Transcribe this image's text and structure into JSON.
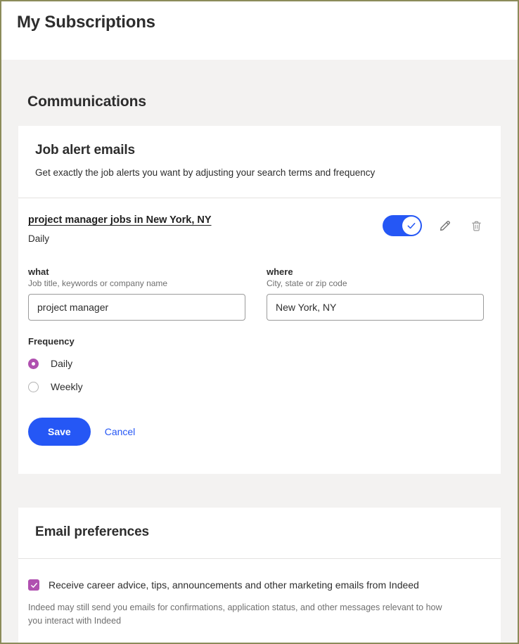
{
  "header": {
    "title": "My Subscriptions"
  },
  "section": {
    "heading": "Communications"
  },
  "job_alerts": {
    "card_title": "Job alert emails",
    "card_subtitle": "Get exactly the job alerts you want by adjusting your search terms and frequency",
    "alert": {
      "name": "project manager jobs in New York, NY",
      "frequency_summary": "Daily",
      "toggle_state": "on",
      "toggle_icon": "check-icon",
      "edit_icon": "pencil-icon",
      "delete_icon": "trash-icon"
    },
    "form": {
      "what_label": "what",
      "what_help": "Job title, keywords or company name",
      "what_value": "project manager",
      "what_placeholder": "Job title, keywords or company name",
      "where_label": "where",
      "where_help": "City, state or zip code",
      "where_value": "New York, NY",
      "where_placeholder": "City, state or zip code",
      "frequency_label": "Frequency",
      "frequency_options": [
        {
          "label": "Daily",
          "selected": true
        },
        {
          "label": "Weekly",
          "selected": false
        }
      ],
      "save_label": "Save",
      "cancel_label": "Cancel"
    }
  },
  "email_preferences": {
    "card_title": "Email preferences",
    "marketing_checkbox": {
      "label": "Receive career advice, tips, announcements and other marketing emails from Indeed",
      "checked": true
    },
    "note": "Indeed may still send you emails for confirmations, application status, and other messages relevant to how you interact with Indeed"
  },
  "colors": {
    "accent_blue": "#2557f5",
    "accent_purple": "#b050b0",
    "page_bg": "#f3f2f1",
    "card_bg": "#ffffff",
    "frame_border": "#8b8b5a"
  }
}
